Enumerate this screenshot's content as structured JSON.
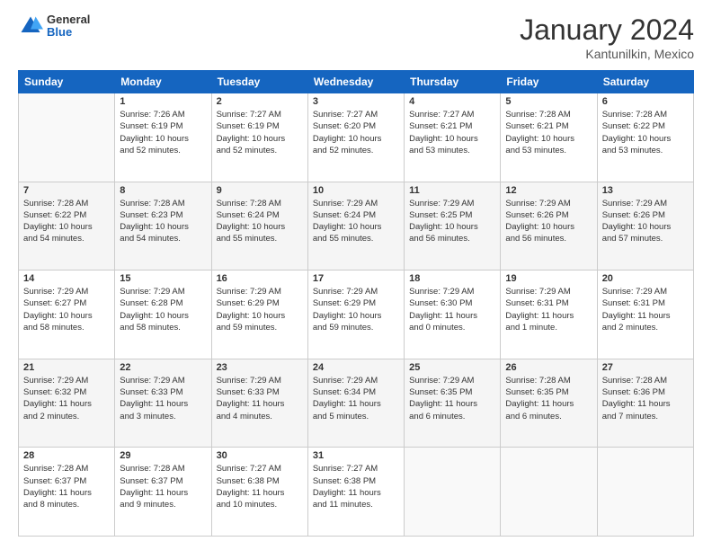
{
  "header": {
    "logo_general": "General",
    "logo_blue": "Blue",
    "month_title": "January 2024",
    "location": "Kantunilkin, Mexico"
  },
  "days_of_week": [
    "Sunday",
    "Monday",
    "Tuesday",
    "Wednesday",
    "Thursday",
    "Friday",
    "Saturday"
  ],
  "weeks": [
    [
      {
        "day": "",
        "info": ""
      },
      {
        "day": "1",
        "info": "Sunrise: 7:26 AM\nSunset: 6:19 PM\nDaylight: 10 hours\nand 52 minutes."
      },
      {
        "day": "2",
        "info": "Sunrise: 7:27 AM\nSunset: 6:19 PM\nDaylight: 10 hours\nand 52 minutes."
      },
      {
        "day": "3",
        "info": "Sunrise: 7:27 AM\nSunset: 6:20 PM\nDaylight: 10 hours\nand 52 minutes."
      },
      {
        "day": "4",
        "info": "Sunrise: 7:27 AM\nSunset: 6:21 PM\nDaylight: 10 hours\nand 53 minutes."
      },
      {
        "day": "5",
        "info": "Sunrise: 7:28 AM\nSunset: 6:21 PM\nDaylight: 10 hours\nand 53 minutes."
      },
      {
        "day": "6",
        "info": "Sunrise: 7:28 AM\nSunset: 6:22 PM\nDaylight: 10 hours\nand 53 minutes."
      }
    ],
    [
      {
        "day": "7",
        "info": "Sunrise: 7:28 AM\nSunset: 6:22 PM\nDaylight: 10 hours\nand 54 minutes."
      },
      {
        "day": "8",
        "info": "Sunrise: 7:28 AM\nSunset: 6:23 PM\nDaylight: 10 hours\nand 54 minutes."
      },
      {
        "day": "9",
        "info": "Sunrise: 7:28 AM\nSunset: 6:24 PM\nDaylight: 10 hours\nand 55 minutes."
      },
      {
        "day": "10",
        "info": "Sunrise: 7:29 AM\nSunset: 6:24 PM\nDaylight: 10 hours\nand 55 minutes."
      },
      {
        "day": "11",
        "info": "Sunrise: 7:29 AM\nSunset: 6:25 PM\nDaylight: 10 hours\nand 56 minutes."
      },
      {
        "day": "12",
        "info": "Sunrise: 7:29 AM\nSunset: 6:26 PM\nDaylight: 10 hours\nand 56 minutes."
      },
      {
        "day": "13",
        "info": "Sunrise: 7:29 AM\nSunset: 6:26 PM\nDaylight: 10 hours\nand 57 minutes."
      }
    ],
    [
      {
        "day": "14",
        "info": "Sunrise: 7:29 AM\nSunset: 6:27 PM\nDaylight: 10 hours\nand 58 minutes."
      },
      {
        "day": "15",
        "info": "Sunrise: 7:29 AM\nSunset: 6:28 PM\nDaylight: 10 hours\nand 58 minutes."
      },
      {
        "day": "16",
        "info": "Sunrise: 7:29 AM\nSunset: 6:29 PM\nDaylight: 10 hours\nand 59 minutes."
      },
      {
        "day": "17",
        "info": "Sunrise: 7:29 AM\nSunset: 6:29 PM\nDaylight: 10 hours\nand 59 minutes."
      },
      {
        "day": "18",
        "info": "Sunrise: 7:29 AM\nSunset: 6:30 PM\nDaylight: 11 hours\nand 0 minutes."
      },
      {
        "day": "19",
        "info": "Sunrise: 7:29 AM\nSunset: 6:31 PM\nDaylight: 11 hours\nand 1 minute."
      },
      {
        "day": "20",
        "info": "Sunrise: 7:29 AM\nSunset: 6:31 PM\nDaylight: 11 hours\nand 2 minutes."
      }
    ],
    [
      {
        "day": "21",
        "info": "Sunrise: 7:29 AM\nSunset: 6:32 PM\nDaylight: 11 hours\nand 2 minutes."
      },
      {
        "day": "22",
        "info": "Sunrise: 7:29 AM\nSunset: 6:33 PM\nDaylight: 11 hours\nand 3 minutes."
      },
      {
        "day": "23",
        "info": "Sunrise: 7:29 AM\nSunset: 6:33 PM\nDaylight: 11 hours\nand 4 minutes."
      },
      {
        "day": "24",
        "info": "Sunrise: 7:29 AM\nSunset: 6:34 PM\nDaylight: 11 hours\nand 5 minutes."
      },
      {
        "day": "25",
        "info": "Sunrise: 7:29 AM\nSunset: 6:35 PM\nDaylight: 11 hours\nand 6 minutes."
      },
      {
        "day": "26",
        "info": "Sunrise: 7:28 AM\nSunset: 6:35 PM\nDaylight: 11 hours\nand 6 minutes."
      },
      {
        "day": "27",
        "info": "Sunrise: 7:28 AM\nSunset: 6:36 PM\nDaylight: 11 hours\nand 7 minutes."
      }
    ],
    [
      {
        "day": "28",
        "info": "Sunrise: 7:28 AM\nSunset: 6:37 PM\nDaylight: 11 hours\nand 8 minutes."
      },
      {
        "day": "29",
        "info": "Sunrise: 7:28 AM\nSunset: 6:37 PM\nDaylight: 11 hours\nand 9 minutes."
      },
      {
        "day": "30",
        "info": "Sunrise: 7:27 AM\nSunset: 6:38 PM\nDaylight: 11 hours\nand 10 minutes."
      },
      {
        "day": "31",
        "info": "Sunrise: 7:27 AM\nSunset: 6:38 PM\nDaylight: 11 hours\nand 11 minutes."
      },
      {
        "day": "",
        "info": ""
      },
      {
        "day": "",
        "info": ""
      },
      {
        "day": "",
        "info": ""
      }
    ]
  ]
}
